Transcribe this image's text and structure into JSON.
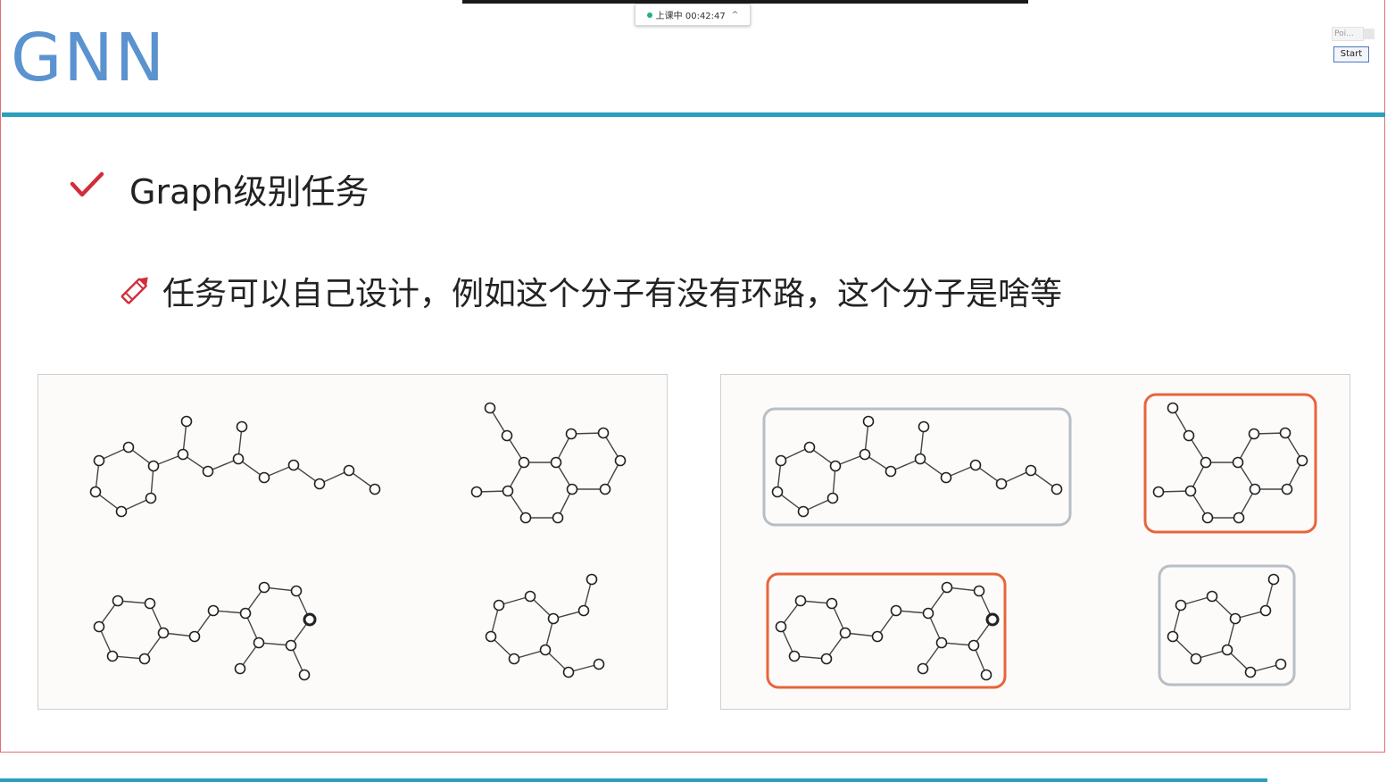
{
  "slide": {
    "title": "GNN",
    "heading": "Graph级别任务",
    "subtext": "任务可以自己设计，例如这个分子有没有环路，这个分子是啥等",
    "heading_icon": "check-icon",
    "subtext_icon": "pencil-icon"
  },
  "status": {
    "label": "上课中 00:42:47",
    "indicator": "green-dot"
  },
  "widget": {
    "label": "Poi...",
    "start": "Start"
  },
  "colors": {
    "title": "#5a93cf",
    "title_rule": "#2a9fbf",
    "check": "#d12e3a",
    "pencil": "#d12e3a",
    "highlight_border": "#e8643a",
    "plain_border": "#b8bec6"
  },
  "molecules": {
    "left_panel": [
      "molecule-1",
      "molecule-2",
      "molecule-3",
      "molecule-4"
    ],
    "right_panel": [
      {
        "molecule": "molecule-1",
        "highlighted": false
      },
      {
        "molecule": "molecule-2",
        "highlighted": true
      },
      {
        "molecule": "molecule-3",
        "highlighted": true
      },
      {
        "molecule": "molecule-4",
        "highlighted": false
      }
    ]
  }
}
